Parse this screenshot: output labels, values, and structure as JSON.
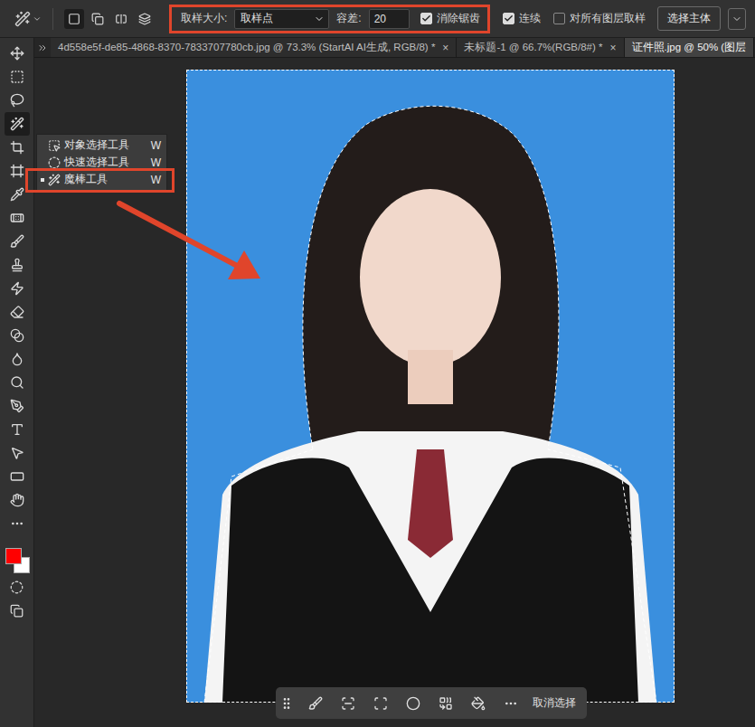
{
  "options_bar": {
    "selection_modes": [
      {
        "selected": true
      },
      {
        "selected": false
      },
      {
        "selected": false
      },
      {
        "selected": false
      }
    ],
    "sample_size": {
      "label": "取样大小:",
      "value": "取样点"
    },
    "tolerance": {
      "label": "容差:",
      "value": "20"
    },
    "checkboxes": [
      {
        "label": "消除锯齿",
        "checked": true
      },
      {
        "label": "连续",
        "checked": true
      },
      {
        "label": "对所有图层取样",
        "checked": false
      }
    ],
    "select_subject_button": "选择主体"
  },
  "tabs": [
    {
      "label": "4d558e5f-de85-4868-8370-7833707780cb.jpg @ 73.3% (StartAI AI生成, RGB/8) *",
      "close": "×",
      "selected": false
    },
    {
      "label": "未标题-1 @ 66.7%(RGB/8#) *",
      "close": "×",
      "selected": false
    },
    {
      "label": "证件照.jpg @ 50% (图层",
      "close": "",
      "selected": true
    }
  ],
  "tools": [
    {
      "selected": false
    },
    {
      "selected": false
    },
    {
      "selected": false
    },
    {
      "selected": true
    },
    {
      "selected": false
    },
    {
      "selected": false
    },
    {
      "selected": false
    },
    {
      "selected": false
    },
    {
      "selected": false
    },
    {
      "selected": false
    },
    {
      "selected": false
    },
    {
      "selected": false
    },
    {
      "selected": false
    },
    {
      "selected": false
    },
    {
      "selected": false
    },
    {
      "selected": false
    },
    {
      "selected": false
    },
    {
      "selected": false
    },
    {
      "selected": false
    },
    {
      "selected": false
    }
  ],
  "colors": {
    "foreground": "#ff0000",
    "background": "#ffffff"
  },
  "flyout": {
    "items": [
      {
        "label": "对象选择工具",
        "shortcut": "W",
        "selected": false
      },
      {
        "label": "快速选择工具",
        "shortcut": "W",
        "selected": false
      },
      {
        "label": "魔棒工具",
        "shortcut": "W",
        "selected": true
      }
    ]
  },
  "canvas": {
    "has_selection": true
  },
  "task_bar": {
    "deselect_button": "取消选择"
  }
}
